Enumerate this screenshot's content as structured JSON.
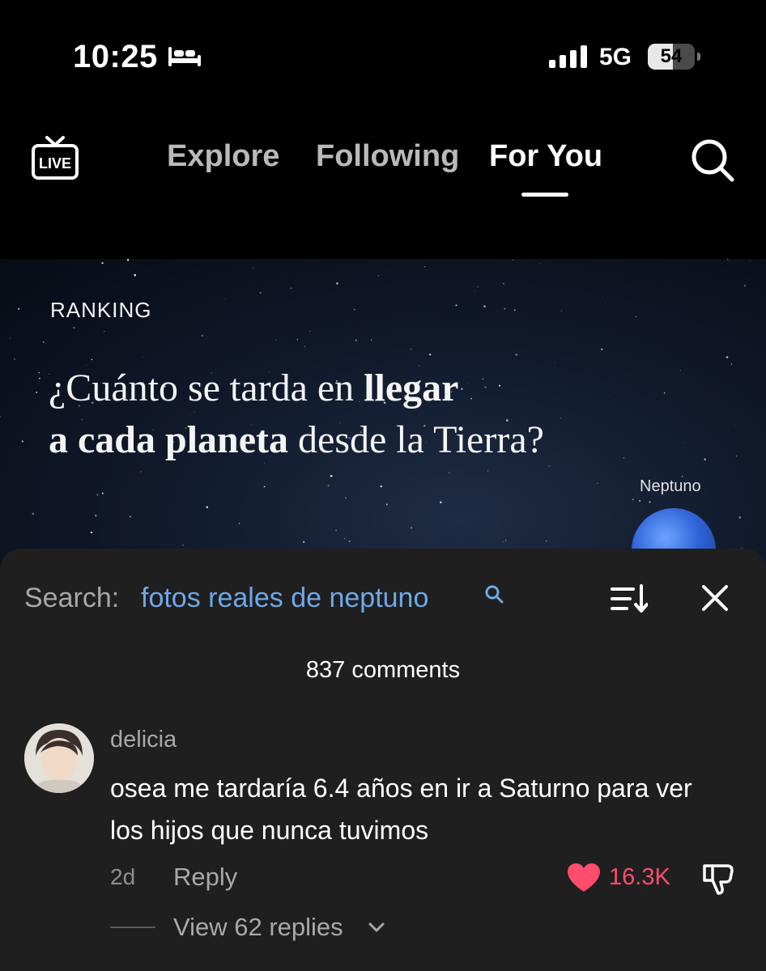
{
  "status_bar": {
    "time": "10:25",
    "sleep_icon": "bed-icon",
    "network": "5G",
    "battery": 54,
    "battery_text": "54"
  },
  "nav": {
    "live_icon": "live-tv-icon",
    "tabs": [
      {
        "label": "Explore",
        "active": false
      },
      {
        "label": "Following",
        "active": false
      },
      {
        "label": "For You",
        "active": true
      }
    ],
    "search_icon": "search-icon"
  },
  "video": {
    "tag": "RANKING",
    "headline_line1_a": "¿Cuánto se tarda en ",
    "headline_line1_b": "llegar",
    "headline_line2_a": "a cada planeta",
    "headline_line2_b": " desde la Tierra?",
    "planet_label": "Neptuno"
  },
  "comments": {
    "search_prefix": "Search:",
    "search_query": "fotos reales de neptuno",
    "count": "837 comments",
    "colors": {
      "link": "#6fa8e8",
      "like": "#ff4d6d"
    },
    "items": [
      {
        "username": "delicia",
        "text": "osea me tardaría 6.4 años en ir a Saturno para ver los hijos que nunca tuvimos",
        "age": "2d",
        "reply_label": "Reply",
        "likes": "16.3K",
        "view_replies": "View 62 replies"
      }
    ]
  }
}
